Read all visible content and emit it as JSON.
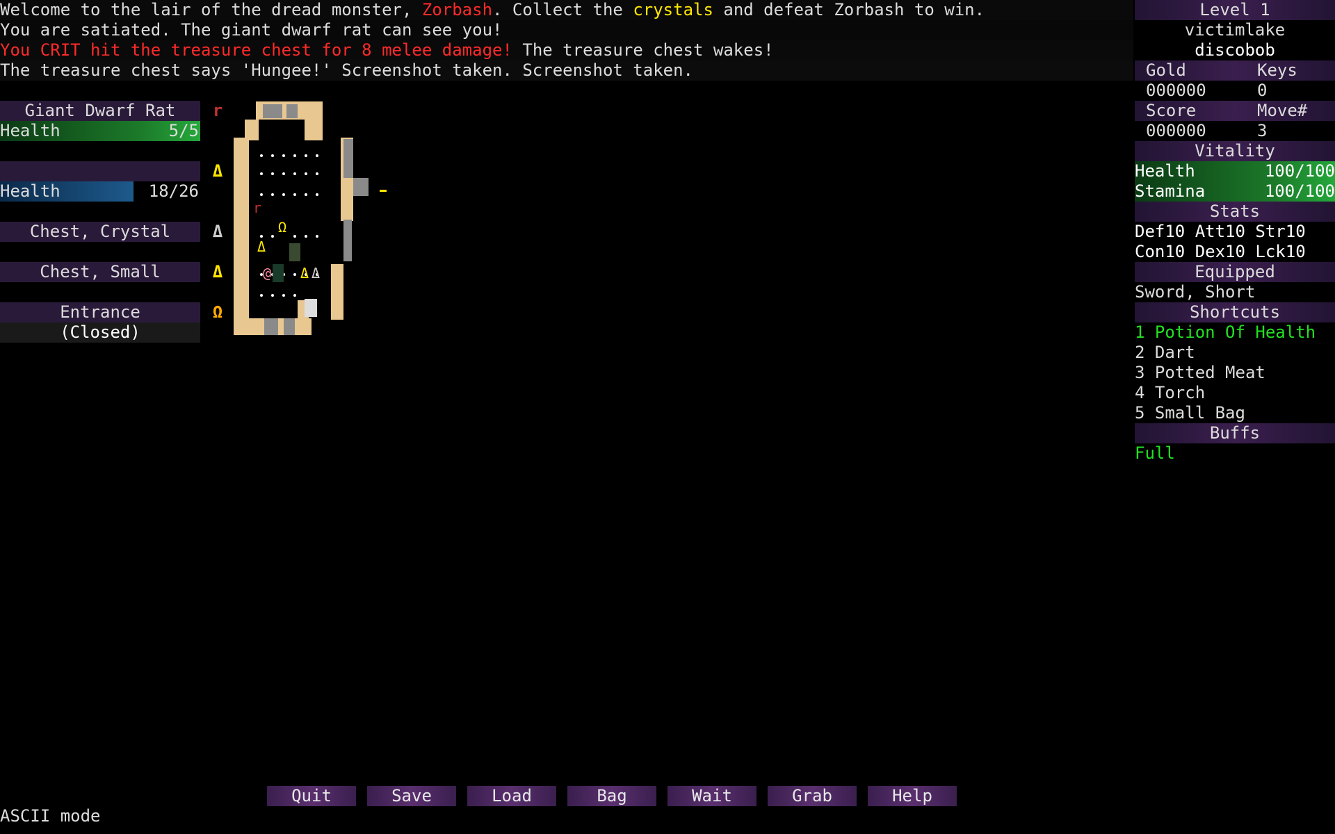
{
  "messages": {
    "line1": {
      "a": "Welcome to the lair of the dread monster, ",
      "b": "Zorbash",
      "c": ". Collect the ",
      "d": "crystals",
      "e": " and defeat Zorbash to win."
    },
    "line2": "You are satiated. The giant dwarf rat can see you!",
    "line3": {
      "a": "You CRIT hit the treasure chest for 8 melee damage!",
      "b": " The treasure chest wakes!"
    },
    "line4": "The treasure chest says 'Hungee!' Screenshot taken. Screenshot taken."
  },
  "left_panel": {
    "target_name": "Giant Dwarf Rat",
    "target_health_label": "Health",
    "target_health_value": "5/5",
    "player_health_label": "Health",
    "player_health_value": "18/26",
    "chest_crystal": "Chest, Crystal",
    "chest_small": "Chest, Small",
    "entrance": "Entrance",
    "entrance_state": "(Closed)",
    "glyph_rat": "r",
    "glyph_delta": "Δ",
    "glyph_omega": "Ω"
  },
  "right_panel": {
    "level": "Level 1",
    "name1": "victimlake",
    "name2": "discobob",
    "gold_label": "Gold",
    "keys_label": "Keys",
    "gold_value": "000000",
    "keys_value": "0",
    "score_label": "Score",
    "move_label": "Move#",
    "score_value": "000000",
    "move_value": "3",
    "vitality_header": "Vitality",
    "health_label": "Health",
    "health_value": "100/100",
    "stamina_label": "Stamina",
    "stamina_value": "100/100",
    "stats_header": "Stats",
    "stats_row1": "Def10 Att10 Str10",
    "stats_row2": "Con10 Dex10 Lck10",
    "equipped_header": "Equipped",
    "equipped_item": "Sword, Short",
    "shortcuts_header": "Shortcuts",
    "shortcuts": [
      "1 Potion Of Health",
      "2 Dart",
      "3 Potted Meat",
      "4 Torch",
      "5 Small Bag"
    ],
    "buffs_header": "Buffs",
    "buffs": "Full"
  },
  "buttons": [
    "Quit",
    "Save",
    "Load",
    "Bag",
    "Wait",
    "Grab",
    "Help"
  ],
  "status": "ASCII mode",
  "colors": {
    "accent": "#3a1f4e",
    "wall": "#e8c890",
    "crit": "#ff2a2a",
    "crystal": "#ffe600",
    "buff": "#22e022"
  }
}
